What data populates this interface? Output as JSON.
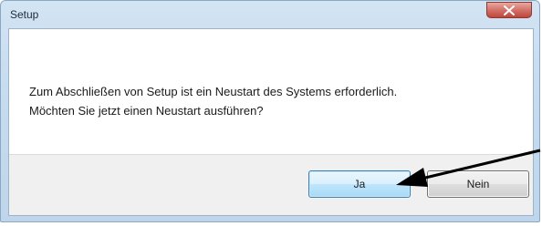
{
  "window": {
    "title": "Setup"
  },
  "dialog": {
    "message_line1": "Zum Abschließen von Setup ist ein Neustart des Systems erforderlich.",
    "message_line2": "Möchten Sie jetzt einen Neustart ausführen?"
  },
  "buttons": {
    "yes_label": "Ja",
    "no_label": "Nein"
  },
  "icons": {
    "close": "close-icon",
    "annotation": "arrow-annotation"
  },
  "colors": {
    "default_button_border": "#3c7fb1",
    "close_button": "#c0463b",
    "annotation_arrow": "#000000"
  }
}
